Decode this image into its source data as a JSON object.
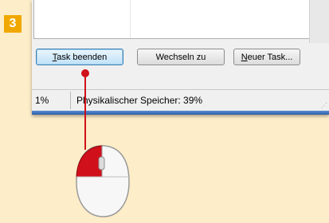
{
  "step": {
    "number": "3"
  },
  "buttons": {
    "end_task": "Task beenden",
    "switch_to": "Wechseln zu",
    "new_task": "Neuer Task..."
  },
  "status": {
    "cpu_percent": "1%",
    "memory": "Physikalischer Speicher: 39%"
  },
  "colors": {
    "background": "#fdedc8",
    "badge": "#f0a800",
    "pointer": "#d0101a",
    "window_accent": "#2d5ea8"
  },
  "icons": [
    "mouse-icon",
    "resize-grip-icon"
  ]
}
